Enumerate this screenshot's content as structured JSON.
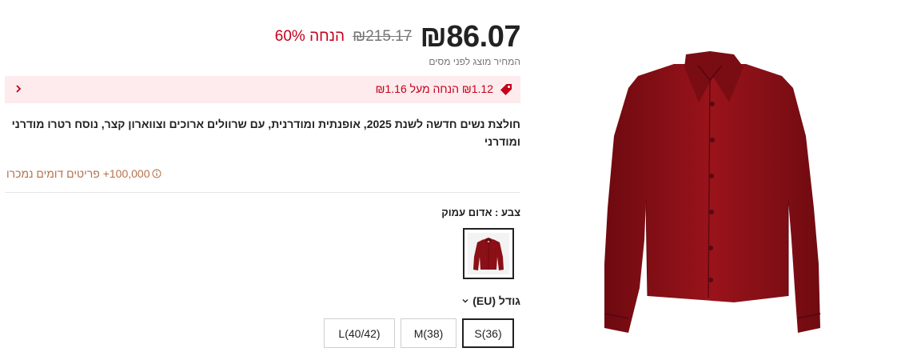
{
  "price": {
    "current": "₪86.07",
    "original": "₪215.17",
    "discount": "60% הנחה",
    "tax_note": "המחיר מוצג לפני מסים"
  },
  "promo": {
    "text": "₪1.12 הנחה מעל ₪1.16",
    "tag_icon": "price-tag-icon",
    "chevron_icon": "chevron-left-icon"
  },
  "product": {
    "title": "חולצת נשים חדשה לשנת 2025, אופנתית ומודרנית, עם שרוולים ארוכים וצווארון קצר, נוסח רטרו מודרני ומודרני",
    "sold_text": "100,000+ פריטים דומים נמכרו",
    "color_label": "צבע : אדום עמוק",
    "size_label": "גודל (EU)",
    "sizes": [
      "S(36)",
      "M(38)",
      "L(40/42)"
    ],
    "selected_size": "S(36)"
  },
  "colors": {
    "accent": "#c4001b",
    "promo_bg": "#fdebed",
    "sold_text": "#b5714a",
    "shirt": "#8b0f16"
  }
}
